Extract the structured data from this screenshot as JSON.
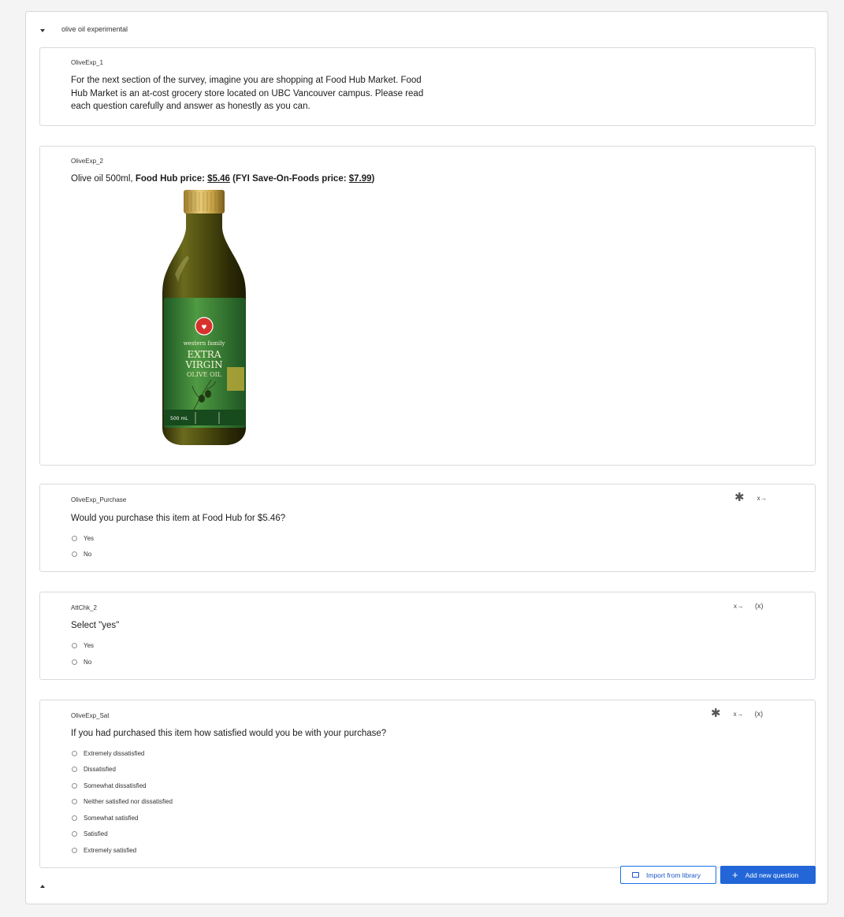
{
  "block": {
    "title": "olive oil experimental"
  },
  "questions": {
    "q1": {
      "id": "OliveExp_1",
      "text_lines": [
        "For the next section of the survey, imagine you are shopping at Food Hub Market. Food",
        "Hub Market is an at-cost grocery store located on UBC Vancouver campus. Please read",
        "each question carefully and answer as honestly as you can."
      ]
    },
    "q2": {
      "id": "OliveExp_2",
      "text_prefix": "Olive oil 500ml, ",
      "text_bold_1": "Food Hub price: ",
      "price_food_hub": "$5.46",
      "text_bold_2": " (FYI Save-On-Foods price: ",
      "price_save_on_foods": "$7.99",
      "text_bold_3": ")",
      "image": {
        "brand": "western family",
        "line1": "EXTRA",
        "line2": "VIRGIN",
        "line3": "OLIVE OIL",
        "size": "500 mL"
      }
    },
    "q3": {
      "id": "OliveExp_Purchase",
      "text": "Would you purchase this item at Food Hub for $5.46?",
      "choices": [
        "Yes",
        "No"
      ],
      "icons": [
        "asterisk-icon",
        "skip-logic-icon"
      ]
    },
    "q4": {
      "id": "AttChk_2",
      "text": "Select \"yes\"",
      "choices": [
        "Yes",
        "No"
      ],
      "icons": [
        "skip-logic-icon",
        "piped-text-icon"
      ]
    },
    "q5": {
      "id": "OliveExp_Sat",
      "text": "If you had purchased this item how satisfied would you be with your purchase?",
      "choices": [
        "Extremely dissatisfied",
        "Dissatisfied",
        "Somewhat dissatisfied",
        "Neither satisfied nor dissatisfied",
        "Somewhat satisfied",
        "Satisfied",
        "Extremely satisfied"
      ],
      "icons": [
        "asterisk-icon",
        "skip-logic-icon",
        "piped-text-icon"
      ]
    }
  },
  "glyphs": {
    "star": "✱",
    "skip": "x→",
    "expr": "(x)",
    "plus": "+"
  },
  "footer": {
    "import_label": "Import from library",
    "add_label": "Add new question"
  },
  "colors": {
    "accent": "#2266d8",
    "border": "#d8dade",
    "bottle_glass": "#5b5a16",
    "bottle_label": "#3f8a3a"
  }
}
